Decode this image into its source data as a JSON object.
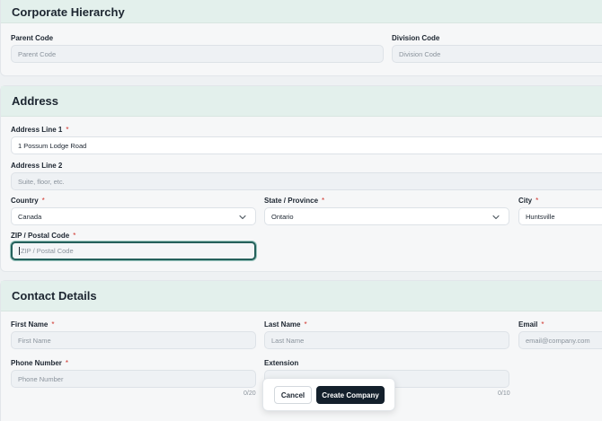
{
  "corporate": {
    "title": "Corporate Hierarchy",
    "parent_code": {
      "label": "Parent Code",
      "placeholder": "Parent Code"
    },
    "division_code": {
      "label": "Division Code",
      "placeholder": "Division Code"
    }
  },
  "address": {
    "title": "Address",
    "line1": {
      "label": "Address Line 1",
      "required": "*",
      "value": "1 Possum Lodge Road"
    },
    "line2": {
      "label": "Address Line 2",
      "placeholder": "Suite, floor, etc."
    },
    "country": {
      "label": "Country",
      "required": "*",
      "value": "Canada"
    },
    "state": {
      "label": "State / Province",
      "required": "*",
      "value": "Ontario"
    },
    "city": {
      "label": "City",
      "required": "*",
      "value": "Huntsville"
    },
    "zip": {
      "label": "ZIP / Postal Code",
      "required": "*",
      "placeholder": "ZIP / Postal Code"
    }
  },
  "contact": {
    "title": "Contact Details",
    "first_name": {
      "label": "First Name",
      "required": "*",
      "placeholder": "First Name"
    },
    "last_name": {
      "label": "Last Name",
      "required": "*",
      "placeholder": "Last Name"
    },
    "email": {
      "label": "Email",
      "required": "*",
      "placeholder": "email@company.com"
    },
    "phone": {
      "label": "Phone Number",
      "required": "*",
      "placeholder": "Phone Number",
      "counter": "0/20"
    },
    "extension": {
      "label": "Extension",
      "placeholder": "",
      "counter": "0/10"
    }
  },
  "actions": {
    "cancel_label": "Cancel",
    "create_label": "Create Company"
  },
  "icons": {
    "select_chevron": "chevron-down-icon"
  },
  "colors": {
    "section_header_bg": "#e3f0ec",
    "focus_ring": "#24605b",
    "primary_button": "#14202c",
    "required_marker": "#d0342c"
  }
}
